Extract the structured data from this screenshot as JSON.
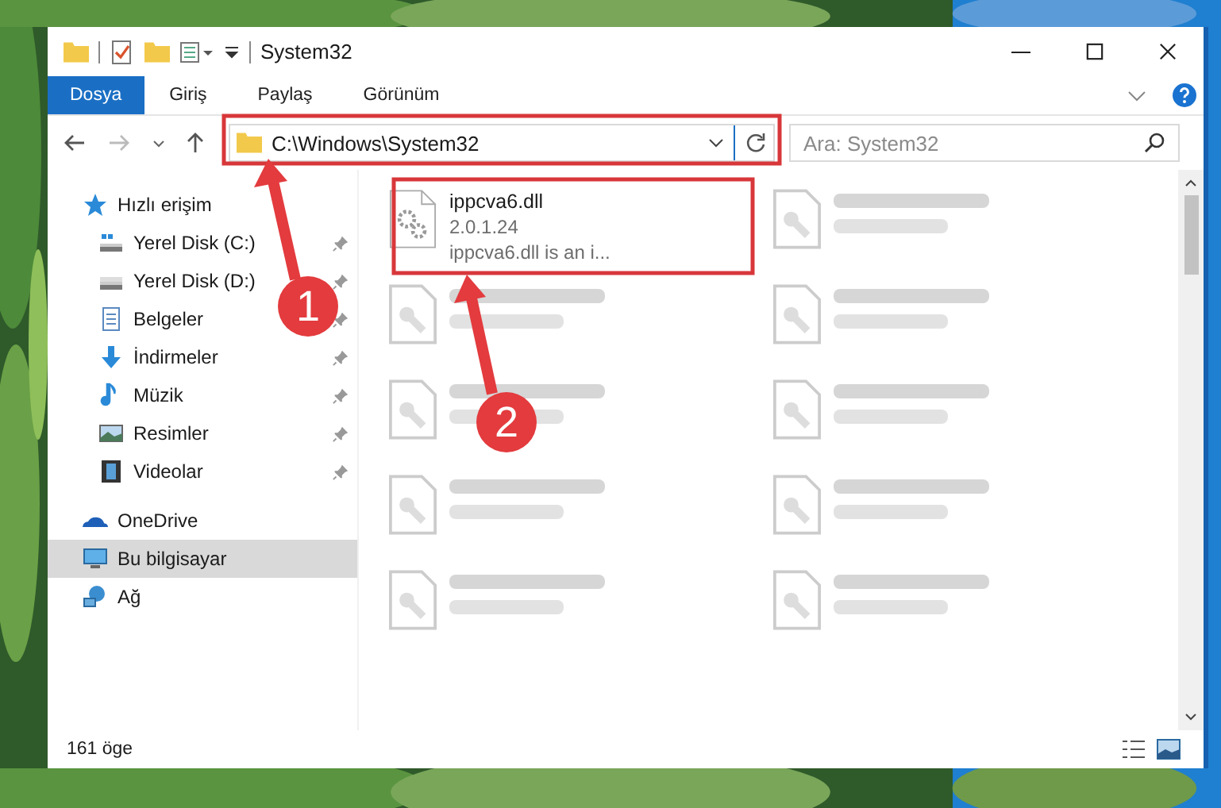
{
  "window": {
    "title": "System32"
  },
  "ribbon_tabs": [
    {
      "label": "Dosya",
      "selected": true
    },
    {
      "label": "Giriş",
      "selected": false
    },
    {
      "label": "Paylaş",
      "selected": false
    },
    {
      "label": "Görünüm",
      "selected": false
    }
  ],
  "address_bar": {
    "value": "C:\\Windows\\System32"
  },
  "search": {
    "placeholder": "Ara: System32"
  },
  "sidebar": {
    "items": [
      {
        "label": "Hızlı erişim",
        "selected": false,
        "children": [
          {
            "label": "Yerel Disk (C:)",
            "selected": false,
            "pinned": true
          },
          {
            "label": "Yerel Disk (D:)",
            "selected": false,
            "pinned": true
          },
          {
            "label": "Belgeler",
            "selected": false,
            "pinned": true
          },
          {
            "label": "İndirmeler",
            "selected": false,
            "pinned": true
          },
          {
            "label": "Müzik",
            "selected": false,
            "pinned": true
          },
          {
            "label": "Resimler",
            "selected": false,
            "pinned": true
          },
          {
            "label": "Videolar",
            "selected": false,
            "pinned": true
          }
        ]
      },
      {
        "label": "OneDrive",
        "selected": false
      },
      {
        "label": "Bu bilgisayar",
        "selected": true
      },
      {
        "label": "Ağ",
        "selected": false
      }
    ]
  },
  "files": [
    {
      "kind": "detail",
      "name": "ippcva6.dll",
      "lines": [
        "2.0.1.24",
        "ippcva6.dll is an i..."
      ]
    },
    {
      "kind": "blurred"
    },
    {
      "kind": "blurred"
    },
    {
      "kind": "blurred"
    },
    {
      "kind": "blurred"
    },
    {
      "kind": "blurred"
    },
    {
      "kind": "blurred"
    },
    {
      "kind": "blurred"
    },
    {
      "kind": "blurred"
    },
    {
      "kind": "blurred"
    }
  ],
  "status_bar": {
    "item_count": "161 öge"
  },
  "annotations": [
    {
      "label": "1"
    },
    {
      "label": "2"
    }
  ]
}
